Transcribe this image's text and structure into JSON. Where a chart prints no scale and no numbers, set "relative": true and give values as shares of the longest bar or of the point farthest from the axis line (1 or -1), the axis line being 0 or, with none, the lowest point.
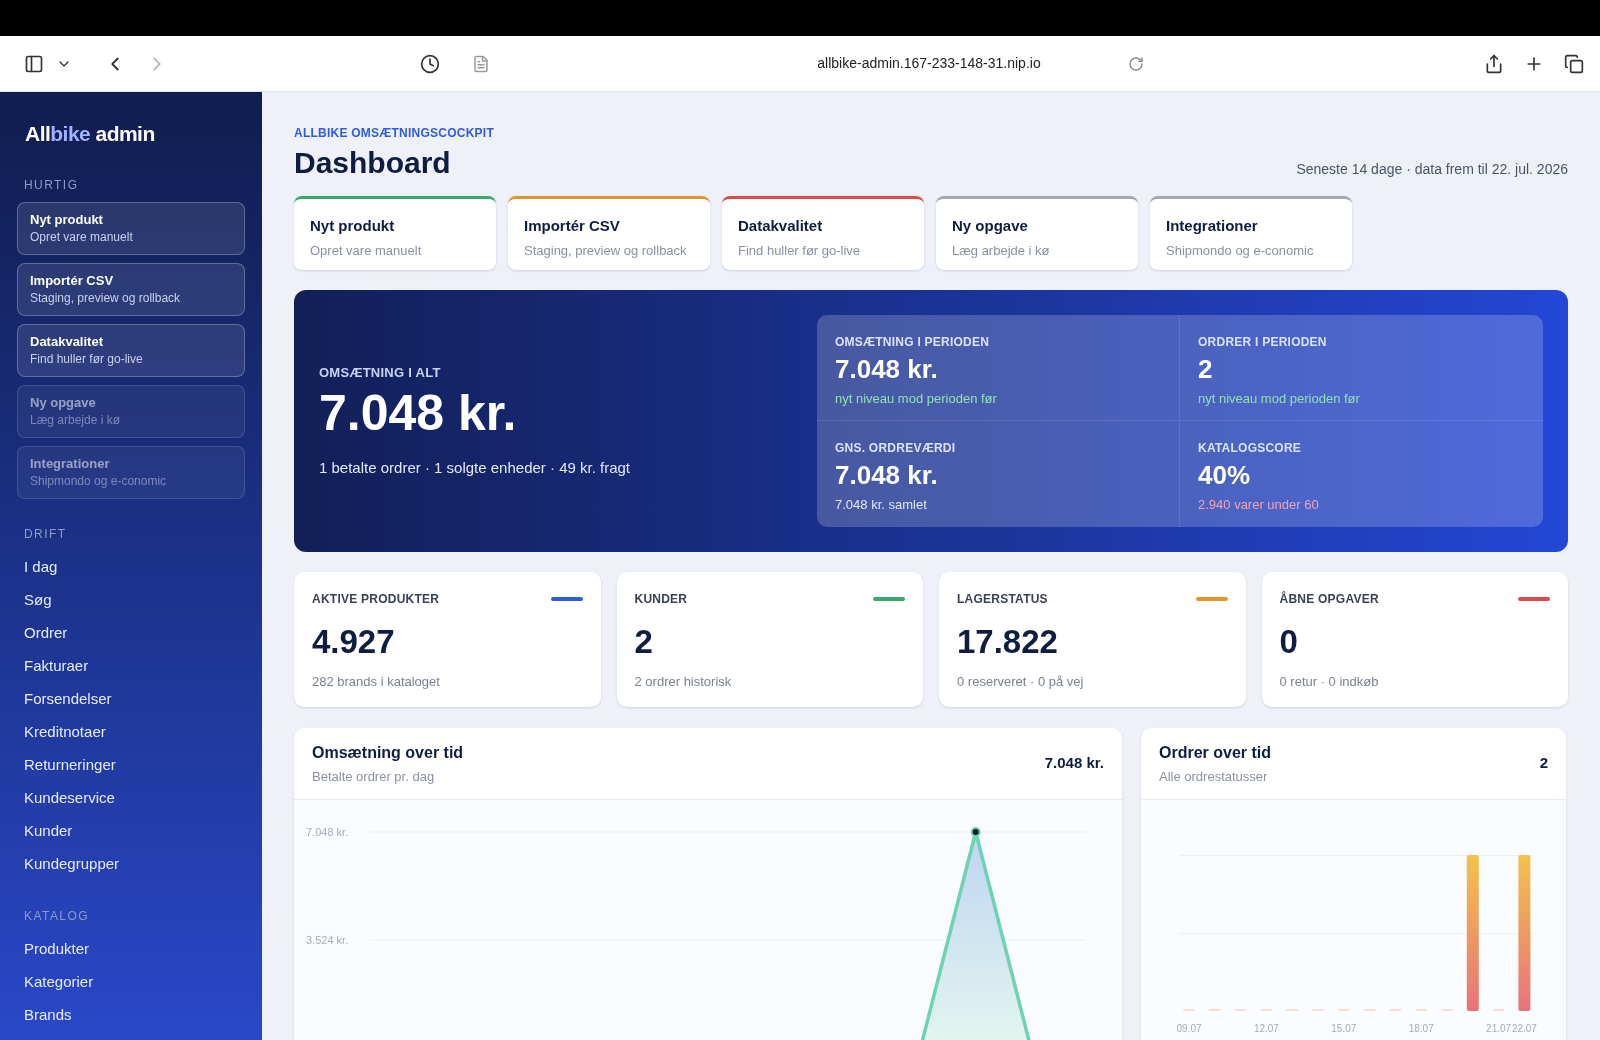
{
  "browser": {
    "url": "allbike-admin.167-233-148-31.nip.io"
  },
  "sidebar": {
    "brand": {
      "prefix": "All",
      "highlight": "bike",
      "suffix": " admin"
    },
    "sections": [
      {
        "title": "HURTIG",
        "kind": "cards",
        "items": [
          {
            "title": "Nyt produkt",
            "subtitle": "Opret vare manuelt",
            "disabled": false
          },
          {
            "title": "Importér CSV",
            "subtitle": "Staging, preview og rollback",
            "disabled": false
          },
          {
            "title": "Datakvalitet",
            "subtitle": "Find huller før go-live",
            "disabled": false
          },
          {
            "title": "Ny opgave",
            "subtitle": "Læg arbejde i kø",
            "disabled": true
          },
          {
            "title": "Integrationer",
            "subtitle": "Shipmondo og e-conomic",
            "disabled": true
          }
        ]
      },
      {
        "title": "DRIFT",
        "kind": "links",
        "items": [
          {
            "label": "I dag"
          },
          {
            "label": "Søg"
          },
          {
            "label": "Ordrer"
          },
          {
            "label": "Fakturaer"
          },
          {
            "label": "Forsendelser"
          },
          {
            "label": "Kreditnotaer"
          },
          {
            "label": "Returneringer"
          },
          {
            "label": "Kundeservice"
          },
          {
            "label": "Kunder"
          },
          {
            "label": "Kundegrupper"
          }
        ]
      },
      {
        "title": "KATALOG",
        "kind": "links",
        "items": [
          {
            "label": "Produkter"
          },
          {
            "label": "Kategorier"
          },
          {
            "label": "Brands"
          }
        ]
      }
    ]
  },
  "header": {
    "eyebrow": "ALLBIKE OMSÆTNINGSCOCKPIT",
    "title": "Dashboard",
    "period": "Seneste 14 dage · data frem til 22. jul. 2026"
  },
  "quick_actions": [
    {
      "title": "Nyt produkt",
      "subtitle": "Opret vare manuelt",
      "color": "#3aa76d"
    },
    {
      "title": "Importér CSV",
      "subtitle": "Staging, preview og rollback",
      "color": "#e0952f"
    },
    {
      "title": "Datakvalitet",
      "subtitle": "Find huller før go-live",
      "color": "#dc4a4a"
    },
    {
      "title": "Ny opgave",
      "subtitle": "Læg arbejde i kø",
      "color": "#a3a8b4"
    },
    {
      "title": "Integrationer",
      "subtitle": "Shipmondo og e-conomic",
      "color": "#a3a8b4"
    }
  ],
  "hero": {
    "label": "OMSÆTNING I ALT",
    "value": "7.048 kr.",
    "detail": "1 betalte ordrer · 1 solgte enheder · 49 kr. fragt",
    "metrics": [
      {
        "label": "OMSÆTNING I PERIODEN",
        "value": "7.048 kr.",
        "note": "nyt niveau mod perioden før",
        "color": "#8fe0b5"
      },
      {
        "label": "ORDRER I PERIODEN",
        "value": "2",
        "note": "nyt niveau mod perioden før",
        "color": "#8fe0b5"
      },
      {
        "label": "GNS. ORDREVÆRDI",
        "value": "7.048 kr.",
        "note": "7.048 kr. samlet",
        "color": "#e1e6ff"
      },
      {
        "label": "KATALOGSCORE",
        "value": "40%",
        "note": "2.940 varer under 60",
        "color": "#f4a3b6"
      }
    ]
  },
  "stats": [
    {
      "label": "AKTIVE PRODUKTER",
      "value": "4.927",
      "note": "282 brands i kataloget",
      "color": "#2f5be0"
    },
    {
      "label": "KUNDER",
      "value": "2",
      "note": "2 ordrer historisk",
      "color": "#3aa76d"
    },
    {
      "label": "LAGERSTATUS",
      "value": "17.822",
      "note": "0 reserveret · 0 på vej",
      "color": "#e0952f"
    },
    {
      "label": "ÅBNE OPGAVER",
      "value": "0",
      "note": "0 retur · 0 indkøb",
      "color": "#dc4a4a"
    }
  ],
  "charts": [
    {
      "title": "Omsætning over tid",
      "subtitle": "Betalte ordrer pr. dag",
      "total": "7.048 kr.",
      "chart_data": {
        "type": "area",
        "series": [
          {
            "color": "#6dd3b0",
            "values": [
              0,
              0,
              0,
              0,
              0,
              0,
              0,
              0,
              0,
              0,
              0,
              7.048,
              0,
              0
            ]
          }
        ],
        "ylim": [
          0,
          7.048
        ],
        "yticks": [
          {
            "value": 3.524,
            "label": "3.524 kr."
          },
          {
            "value": 7.048,
            "label": "7.048 kr."
          }
        ]
      }
    },
    {
      "title": "Ordrer over tid",
      "subtitle": "Alle ordrestatusser",
      "total": "2",
      "chart_data": {
        "type": "bar",
        "relative": true,
        "categories": [
          "09.07",
          null,
          null,
          "12.07",
          null,
          null,
          "15.07",
          null,
          null,
          "18.07",
          null,
          null,
          "21.07",
          "22.07"
        ],
        "series": [
          {
            "color": "#f0a35e",
            "values": [
              0,
              0,
              0,
              0,
              0,
              0,
              0,
              0,
              0,
              0,
              0,
              1,
              0,
              1
            ]
          }
        ]
      }
    }
  ]
}
